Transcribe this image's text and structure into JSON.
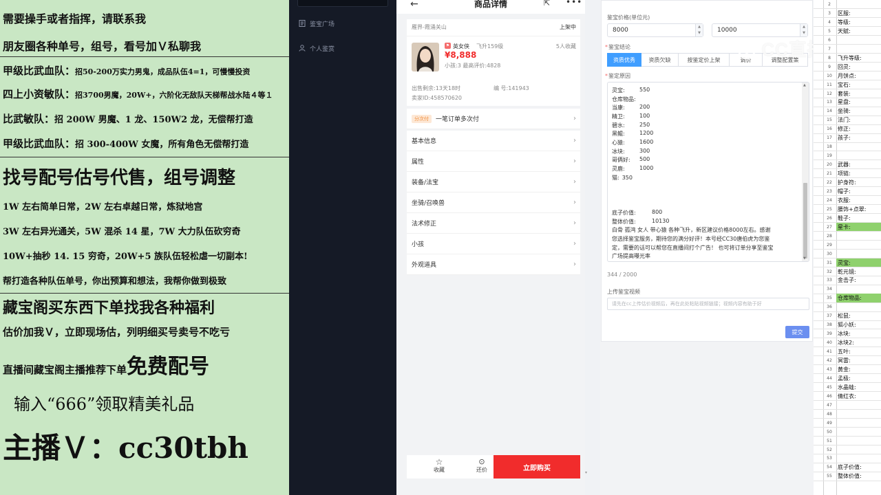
{
  "ad": {
    "line1": "需要操手或者指挥，请联系我",
    "line2": "朋友圈各种单号，组号，看号加Ｖ私聊我",
    "line3_head": "甲级比武血队：",
    "line3_body": "招50-200万实力男鬼，成品队伍4=1，可慢慢投资",
    "line4_head": "四上小资敏队：",
    "line4_body": "招3700男魔，20W+，六阶化无敌队天梯帮战水陆４等１",
    "line5_head": "比武敏队：",
    "line5_body": "招 200W 男魔、1 龙、150W2 龙，无偿帮打造",
    "line6_head": "甲级比武血队：",
    "line6_body": "招 300-400W 女魔，所有角色无偿帮打造",
    "line7": "找号配号估号代售，组号调整",
    "line8": "1W 左右简单日常，2W 左右卓越日常，炼狱地宫",
    "line9": "3W 左右异光通关，5W 混杀 14 星，7W 大力队伍砍穷奇",
    "line10": "10W+抽秒 14. 15 穷奇，20W+5 族队伍轻松虐一切副本!",
    "line11": "帮打造各种队伍单号，你出预算和想法，我帮你做到极致",
    "line12": "藏宝阁买东西下单找我各种福利",
    "line13": "估价加我Ｖ，立即现场估，列明细买号卖号不吃亏",
    "line14a": "直播间藏宝阁主播推荐下单",
    "line14b": "免费配号",
    "line15": "输入“666”领取精美礼品",
    "line16": "主播Ｖ：cc30tbh"
  },
  "sidebar": {
    "items": [
      {
        "label": "鉴宝广场",
        "icon": "document-icon"
      },
      {
        "label": "个人鉴赏",
        "icon": "user-icon"
      }
    ]
  },
  "phone": {
    "title": "商品详情",
    "server": "雁界-霞涌关山",
    "status": "上架中",
    "char_name": "英女侠",
    "char_level": "飞升159级",
    "favorites": "5人收藏",
    "price": "¥8,888",
    "sub_info": "小孩:3 最高评价:4828",
    "remaining": "出售剩余:13天18时",
    "number": "编 号:141943",
    "seller": "卖家ID:458570620",
    "installment_tag": "分次付",
    "installment_text": "一笔订单多次付",
    "menu": [
      "基本信息",
      "属性",
      "装备/法宝",
      "坐骑/召唤兽",
      "法术修正",
      "小孩",
      "外观道具"
    ],
    "footer": {
      "fav": "收藏",
      "bargain": "还价",
      "buy": "立即购买"
    }
  },
  "form": {
    "price_label": "鉴宝价格(单位元)",
    "price_min": "8000",
    "price_max": "10000",
    "conclusion_label": "鉴宝结论",
    "tabs": [
      "资质优秀",
      "资质欠缺",
      "按鉴定价上架",
      "调价",
      "调整配置策"
    ],
    "reason_label": "鉴定原因",
    "reason_lines": [
      {
        "k": "灵宝:",
        "v": "550"
      },
      {
        "k": "仓库物品:",
        "v": ""
      },
      {
        "k": "当康:",
        "v": "200"
      },
      {
        "k": "精卫:",
        "v": "100"
      },
      {
        "k": "碧水:",
        "v": "250"
      },
      {
        "k": "黑鲲:",
        "v": "1200"
      },
      {
        "k": "心猿:",
        "v": "1600"
      },
      {
        "k": "冰块:",
        "v": "300"
      },
      {
        "k": "哥俩好:",
        "v": "500"
      },
      {
        "k": "灵鹿:",
        "v": "1000"
      },
      {
        "k": "猫:",
        "v": "350"
      }
    ],
    "base_value_label": "底子价值:",
    "base_value": "800",
    "total_value_label": "整体价值:",
    "total_value": "10130",
    "summary": [
      "白骨 孤鸿 女人        带心猿 各种飞升，新区建议价格8000左右。感谢",
      "您选择鉴宝服务，期待您的满分好评！本号经CC30唐伯虎为您鉴",
      "定，需要的话可以帮您在直播间打个广告！    也可将订单分享至鉴宝",
      "广场提高曝光率"
    ],
    "counter": "344 / 2000",
    "upload_label": "上传鉴宝视频",
    "upload_placeholder": "请先在cc上传估价视频后，再在此处粘贴视频链接；视频内容有助于好",
    "submit": "提交"
  },
  "watermark": "CC直播",
  "sheet": {
    "rows": [
      {
        "n": "2",
        "t": "",
        "g": false
      },
      {
        "n": "3",
        "t": "区服:",
        "g": false
      },
      {
        "n": "4",
        "t": "等级:",
        "g": false
      },
      {
        "n": "5",
        "t": "天赋:",
        "g": false
      },
      {
        "n": "6",
        "t": "",
        "g": false
      },
      {
        "n": "7",
        "t": "",
        "g": false
      },
      {
        "n": "8",
        "t": "飞升等级:",
        "g": false
      },
      {
        "n": "9",
        "t": "回灵:",
        "g": false
      },
      {
        "n": "10",
        "t": "月饼点:",
        "g": false
      },
      {
        "n": "11",
        "t": "宝石:",
        "g": false
      },
      {
        "n": "12",
        "t": "套装:",
        "g": false
      },
      {
        "n": "13",
        "t": "星盘:",
        "g": false
      },
      {
        "n": "14",
        "t": "坐骑:",
        "g": false
      },
      {
        "n": "15",
        "t": "法门:",
        "g": false
      },
      {
        "n": "16",
        "t": "修正:",
        "g": false
      },
      {
        "n": "17",
        "t": "孩子:",
        "g": false
      },
      {
        "n": "18",
        "t": "",
        "g": false
      },
      {
        "n": "19",
        "t": "",
        "g": false
      },
      {
        "n": "20",
        "t": "武器:",
        "g": false
      },
      {
        "n": "21",
        "t": "项链:",
        "g": false
      },
      {
        "n": "22",
        "t": "护身符:",
        "g": false
      },
      {
        "n": "23",
        "t": "帽子:",
        "g": false
      },
      {
        "n": "24",
        "t": "衣服:",
        "g": false
      },
      {
        "n": "25",
        "t": "腰饰+点翠:",
        "g": false
      },
      {
        "n": "26",
        "t": "鞋子:",
        "g": false
      },
      {
        "n": "27",
        "t": "星卡:",
        "g": true
      },
      {
        "n": "28",
        "t": "",
        "g": false
      },
      {
        "n": "29",
        "t": "",
        "g": false
      },
      {
        "n": "30",
        "t": "",
        "g": false
      },
      {
        "n": "31",
        "t": "灵宝:",
        "g": true
      },
      {
        "n": "32",
        "t": "乾元镜:",
        "g": false
      },
      {
        "n": "33",
        "t": "金击子:",
        "g": false
      },
      {
        "n": "34",
        "t": "",
        "g": false
      },
      {
        "n": "35",
        "t": "仓库物品:",
        "g": true
      },
      {
        "n": "36",
        "t": "",
        "g": false
      },
      {
        "n": "37",
        "t": "松鼠:",
        "g": false
      },
      {
        "n": "38",
        "t": "狐小妖:",
        "g": false
      },
      {
        "n": "39",
        "t": "冰块:",
        "g": false
      },
      {
        "n": "40",
        "t": "冰块2:",
        "g": false
      },
      {
        "n": "41",
        "t": "五叶:",
        "g": false
      },
      {
        "n": "42",
        "t": "冥雷:",
        "g": false
      },
      {
        "n": "43",
        "t": "黄金:",
        "g": false
      },
      {
        "n": "44",
        "t": "孟极:",
        "g": false
      },
      {
        "n": "45",
        "t": "水晶蛙:",
        "g": false
      },
      {
        "n": "46",
        "t": "倩红衣:",
        "g": false
      },
      {
        "n": "47",
        "t": "",
        "g": false
      },
      {
        "n": "48",
        "t": "",
        "g": false
      },
      {
        "n": "49",
        "t": "",
        "g": false
      },
      {
        "n": "50",
        "t": "",
        "g": false
      },
      {
        "n": "51",
        "t": "",
        "g": false
      },
      {
        "n": "52",
        "t": "",
        "g": false
      },
      {
        "n": "53",
        "t": "",
        "g": false
      },
      {
        "n": "54",
        "t": "底子价值:",
        "g": false
      },
      {
        "n": "55",
        "t": "整体价值:",
        "g": false
      }
    ]
  }
}
